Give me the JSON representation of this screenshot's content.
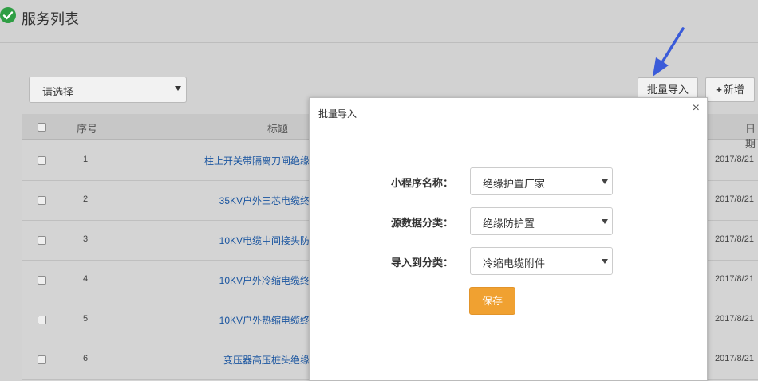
{
  "page": {
    "title": "服务列表",
    "title_icon": "check-circle-icon"
  },
  "toolbar": {
    "filter_select": "请选择",
    "import_button": "批量导入",
    "add_button_plus": "+",
    "add_button": "新增"
  },
  "table": {
    "headers": {
      "no": "序号",
      "title": "标题",
      "date": "日期"
    },
    "rows": [
      {
        "no": "1",
        "title": "柱上开关带隔离刀闸绝缘",
        "date": "2017/8/21"
      },
      {
        "no": "2",
        "title": "35KV户外三芯电缆终",
        "date": "2017/8/21"
      },
      {
        "no": "3",
        "title": "10KV电缆中间接头防",
        "date": "2017/8/21"
      },
      {
        "no": "4",
        "title": "10KV户外冷缩电缆终",
        "date": "2017/8/21"
      },
      {
        "no": "5",
        "title": "10KV户外热缩电缆终",
        "date": "2017/8/21"
      },
      {
        "no": "6",
        "title": "变压器高压桩头绝缘",
        "date": "2017/8/21"
      }
    ]
  },
  "modal": {
    "title": "批量导入",
    "close": "×",
    "fields": [
      {
        "label": "小程序名称：",
        "value": "绝缘护置厂家"
      },
      {
        "label": "源数据分类：",
        "value": "绝缘防护置"
      },
      {
        "label": "导入到分类：",
        "value": "冷缩电缆附件"
      }
    ],
    "save_button": "保存"
  },
  "colors": {
    "accent_orange": "#f0a131",
    "link_blue": "#1a55a0",
    "success_green": "#2f9e44",
    "arrow_blue": "#3a5bd9"
  }
}
